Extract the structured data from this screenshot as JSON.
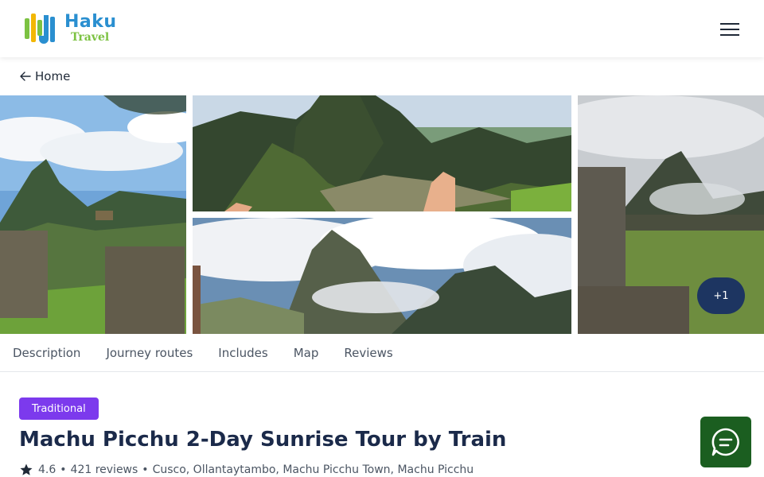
{
  "header": {
    "logo_line1": "Haku",
    "logo_line2": "Travel",
    "menu_icon": "hamburger-icon"
  },
  "breadcrumb": {
    "label": "Home",
    "icon": "arrow-left-icon"
  },
  "gallery": {
    "more_label": "+1"
  },
  "tabs": [
    {
      "label": "Description"
    },
    {
      "label": "Journey routes"
    },
    {
      "label": "Includes"
    },
    {
      "label": "Map"
    },
    {
      "label": "Reviews"
    }
  ],
  "tour": {
    "badge": "Traditional",
    "title": "Machu Picchu 2-Day Sunrise Tour by Train",
    "rating": "4.6",
    "reviews": "421 reviews",
    "locations": "Cusco, Ollantaytambo, Machu Picchu Town, Machu Picchu",
    "separator": "•"
  },
  "colors": {
    "badge": "#7c3aed",
    "title": "#1b2a4a",
    "more_button": "#1d3561",
    "chat_button": "#1b5e20",
    "logo_blue": "#2a8fd0",
    "logo_green": "#7cc242"
  },
  "chat": {
    "icon": "chat-bubble-icon"
  }
}
